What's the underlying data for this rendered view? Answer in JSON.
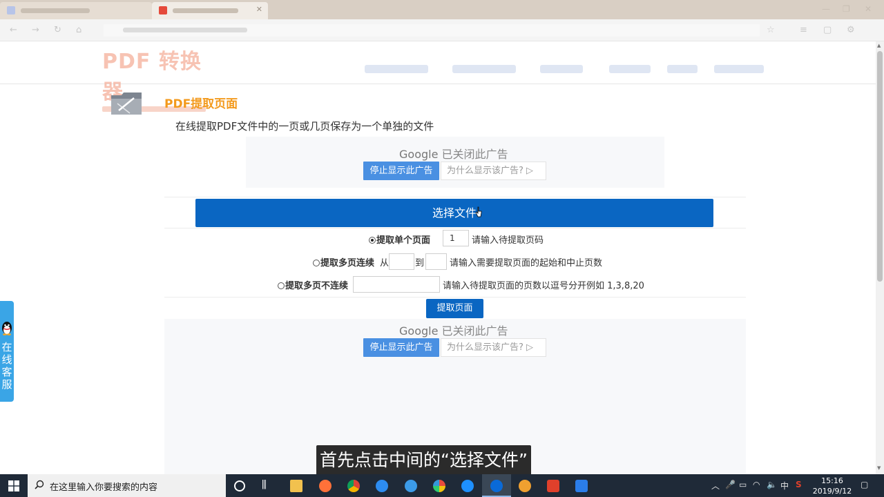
{
  "page": {
    "title": "PDF提取页面",
    "description": "在线提取PDF文件中的一页或几页保存为一个单独的文件",
    "logo_text": "PDF 转换器"
  },
  "ads": {
    "google": "Google",
    "closed_text": "已关闭此广告",
    "stop_label": "停止显示此广告",
    "why_label": "为什么显示该广告?",
    "why_icon": "play-triangle-icon"
  },
  "upload": {
    "choose_label": "选择文件"
  },
  "options": {
    "single": {
      "label": "提取单个页面",
      "value": "1",
      "hint": "请输入待提取页码",
      "selected": true
    },
    "range": {
      "label": "提取多页连续",
      "from_label": "从",
      "to_label": "到",
      "from_value": "",
      "to_value": "",
      "hint": "请输入需要提取页面的起始和中止页数",
      "selected": false
    },
    "multi": {
      "label": "提取多页不连续",
      "value": "",
      "hint": "请输入待提取页面的页数以逗号分开例如 1,3,8,20",
      "selected": false
    }
  },
  "extract_label": "提取页面",
  "float_service": {
    "label": "在线客服"
  },
  "subtitle": "首先点击中间的“选择文件”",
  "taskbar": {
    "search_placeholder": "在这里输入你要搜索的内容",
    "ime": "中",
    "time": "15:16",
    "date": "2019/9/12"
  },
  "colors": {
    "primary_blue": "#0a66c2",
    "title_orange": "#f39a1d",
    "ad_blue": "#4a90e2",
    "float_blue": "#3aa5e6"
  }
}
